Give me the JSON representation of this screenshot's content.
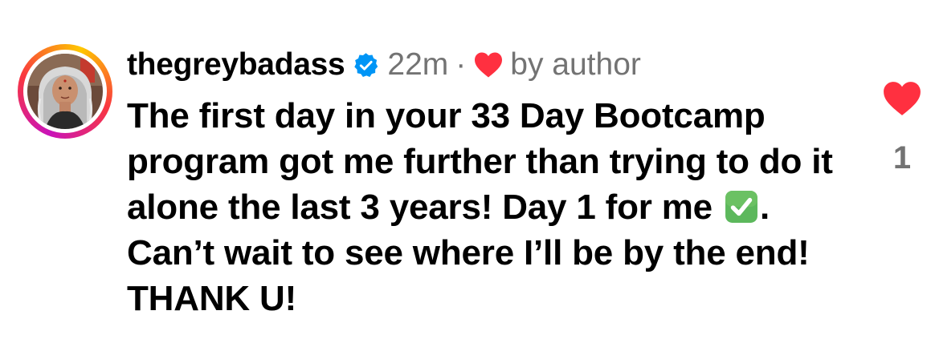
{
  "comment": {
    "username": "thegreybadass",
    "timestamp": "22m",
    "separator": "·",
    "liked_by_author_label": "by author",
    "text_part1": "The first day in your 33 Day Bootcamp program got me further than trying to do it alone the last 3 years! Day 1 for me ",
    "text_part2": ". Can’t wait to see where I’ll be by the end! THANK U!",
    "like_count": "1"
  },
  "icons": {
    "avatar": "avatar-photo",
    "verified": "verified-badge-icon",
    "author_heart": "heart-icon",
    "checkmark": "check-mark-button-emoji",
    "like": "heart-icon"
  },
  "colors": {
    "heart": "#ff3040",
    "verified": "#0095f6",
    "secondary_text": "#737373",
    "check_emoji": "#5cb85c"
  }
}
